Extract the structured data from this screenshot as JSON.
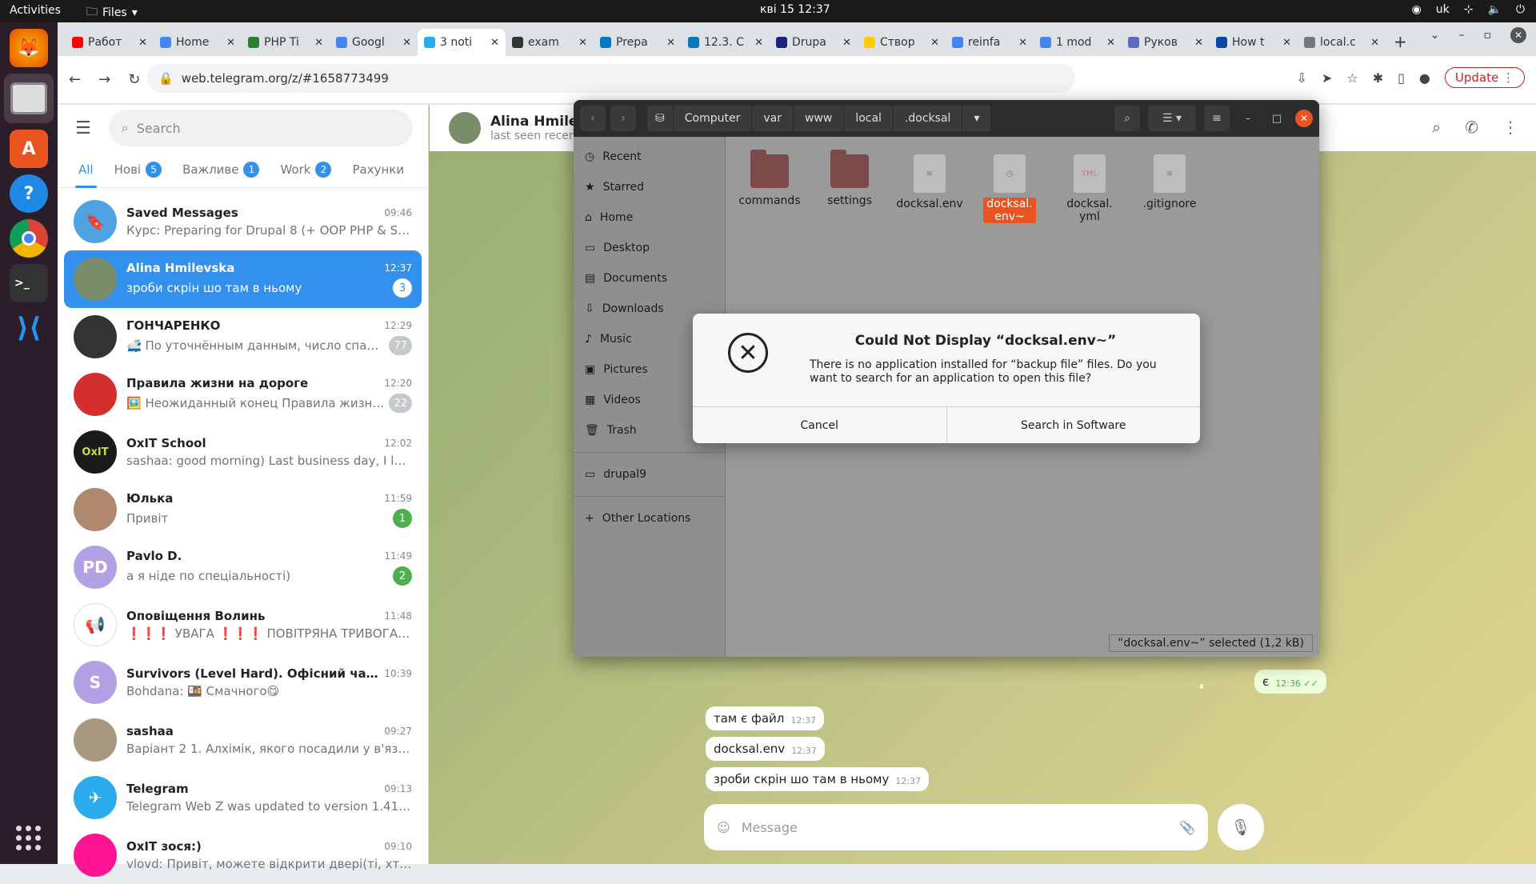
{
  "topbar": {
    "activities": "Activities",
    "app": "Files",
    "clock": "кві 15  12:37",
    "lang": "uk"
  },
  "browser": {
    "tabs": [
      {
        "label": "Работ",
        "color": "#ff0000"
      },
      {
        "label": "Home",
        "color": "#4285f4"
      },
      {
        "label": "PHP Ti",
        "color": "#2e7d32"
      },
      {
        "label": "Googl",
        "color": "#4285f4"
      },
      {
        "label": "3 noti",
        "color": "#2aabee"
      },
      {
        "label": "exam",
        "color": "#333333"
      },
      {
        "label": "Prepa",
        "color": "#0678be"
      },
      {
        "label": "12.3. C",
        "color": "#0678be"
      },
      {
        "label": "Drupa",
        "color": "#1a237e"
      },
      {
        "label": "Створ",
        "color": "#ffcc00"
      },
      {
        "label": "reinfa",
        "color": "#4285f4"
      },
      {
        "label": "1 mod",
        "color": "#4285f4"
      },
      {
        "label": "Руков",
        "color": "#5c6bc0"
      },
      {
        "label": "How t",
        "color": "#0d47a1"
      },
      {
        "label": "local.c",
        "color": "#777777"
      }
    ],
    "url": "web.telegram.org/z/#1658773499",
    "update_label": "Update"
  },
  "telegram": {
    "search_placeholder": "Search",
    "folders": [
      {
        "label": "All",
        "badge": ""
      },
      {
        "label": "Нові",
        "badge": "5"
      },
      {
        "label": "Важливе",
        "badge": "1"
      },
      {
        "label": "Work",
        "badge": "2"
      },
      {
        "label": "Рахунки",
        "badge": ""
      }
    ],
    "chats": [
      {
        "name": "Saved Messages",
        "time": "09:46",
        "msg": "Курс: Preparing for Drupal 8 (+ OOP PHP & Sy...",
        "count": "",
        "avatar": "#4fa3e3",
        "initials": "🔖",
        "badge_style": "none"
      },
      {
        "name": "Alina Hmilevska",
        "time": "12:37",
        "msg": "зроби скрін шо там в ньому",
        "count": "3",
        "avatar": "#7a8d6a",
        "initials": "",
        "badge_style": "white"
      },
      {
        "name": "ГОНЧАРЕНКО",
        "time": "12:29",
        "msg": "🚅 По уточнённым данным, число спасённ...",
        "count": "77",
        "avatar": "#333333",
        "initials": "",
        "badge_style": "grey"
      },
      {
        "name": "Правила жизни на дороге",
        "time": "12:20",
        "msg": "🖼️ Неожиданный конец Правила жизни н...",
        "count": "22",
        "avatar": "#d32f2f",
        "initials": "",
        "badge_style": "grey"
      },
      {
        "name": "OxIT School",
        "time": "12:02",
        "msg": "sashaa: good morning) Last business day, I learn...",
        "count": "",
        "avatar": "#1a1a1a",
        "initials": "OxIT",
        "badge_style": "none"
      },
      {
        "name": "Юлька",
        "time": "11:59",
        "msg": "Привіт",
        "count": "1",
        "avatar": "#b08870",
        "initials": "",
        "badge_style": "green"
      },
      {
        "name": "Pavlo D.",
        "time": "11:49",
        "msg": "а я ніде по спеціальності)",
        "count": "2",
        "avatar": "#b3a1e6",
        "initials": "PD",
        "badge_style": "green"
      },
      {
        "name": "Оповіщення Волинь",
        "time": "11:48",
        "msg": "❗❗❗ УВАГА ❗❗❗ ПОВІТРЯНА ТРИВОГА - У...",
        "count": "",
        "avatar": "#ffffff",
        "initials": "📢",
        "badge_style": "none"
      },
      {
        "name": "Survivors (Level Hard). Офісний чат на...",
        "time": "10:39",
        "msg": "Bohdana: 🍱 Смачного😋",
        "count": "",
        "avatar": "#b3a1e6",
        "initials": "S",
        "badge_style": "none"
      },
      {
        "name": "sashaa",
        "time": "09:27",
        "msg": "Варіант 2 1. Алхімік, якого посадили у в'язниц...",
        "count": "",
        "avatar": "#a89880",
        "initials": "",
        "badge_style": "none"
      },
      {
        "name": "Telegram",
        "time": "09:13",
        "msg": "Telegram Web Z was updated to version 1.41 👏 ...",
        "count": "",
        "avatar": "#2aabee",
        "initials": "✈",
        "badge_style": "none"
      },
      {
        "name": "OxIT зося:)",
        "time": "09:10",
        "msg": "vlovd: Привіт, можете відкрити двері(ті, хто на...",
        "count": "",
        "avatar": "#ff1493",
        "initials": "",
        "badge_style": "none"
      }
    ],
    "header": {
      "name": "Alina Hmilevs",
      "status": "last seen recently"
    },
    "messages": [
      {
        "text": "є",
        "time": "12:36"
      },
      {
        "text": "там є файл",
        "time": "12:37"
      },
      {
        "text": "docksal.env",
        "time": "12:37"
      },
      {
        "text": "зроби скрін шо там в ньому",
        "time": "12:37"
      }
    ],
    "composer_placeholder": "Message"
  },
  "files": {
    "breadcrumbs": [
      "Computer",
      "var",
      "www",
      "local",
      ".docksal"
    ],
    "sidebar": [
      {
        "label": "Recent",
        "icon": "◷"
      },
      {
        "label": "Starred",
        "icon": "★"
      },
      {
        "label": "Home",
        "icon": "⌂"
      },
      {
        "label": "Desktop",
        "icon": "▭"
      },
      {
        "label": "Documents",
        "icon": "▤"
      },
      {
        "label": "Downloads",
        "icon": "⇩"
      },
      {
        "label": "Music",
        "icon": "♪"
      },
      {
        "label": "Pictures",
        "icon": "▣"
      },
      {
        "label": "Videos",
        "icon": "▦"
      },
      {
        "label": "Trash",
        "icon": "🗑"
      }
    ],
    "bookmark": "drupal9",
    "other_locations": "Other Locations",
    "items": [
      {
        "name": "commands",
        "type": "folder"
      },
      {
        "name": "settings",
        "type": "folder"
      },
      {
        "name": "docksal.env",
        "type": "text"
      },
      {
        "name": "docksal.\nenv~",
        "type": "backup"
      },
      {
        "name": "docksal.\nyml",
        "type": "yml"
      },
      {
        "name": ".gitignore",
        "type": "text"
      }
    ],
    "status": "“docksal.env~” selected  (1,2 kB)"
  },
  "dialog": {
    "title": "Could Not Display “docksal.env~”",
    "message": "There is no application installed for “backup file” files. Do you want to search for an application to open this file?",
    "cancel": "Cancel",
    "search": "Search in Software"
  }
}
